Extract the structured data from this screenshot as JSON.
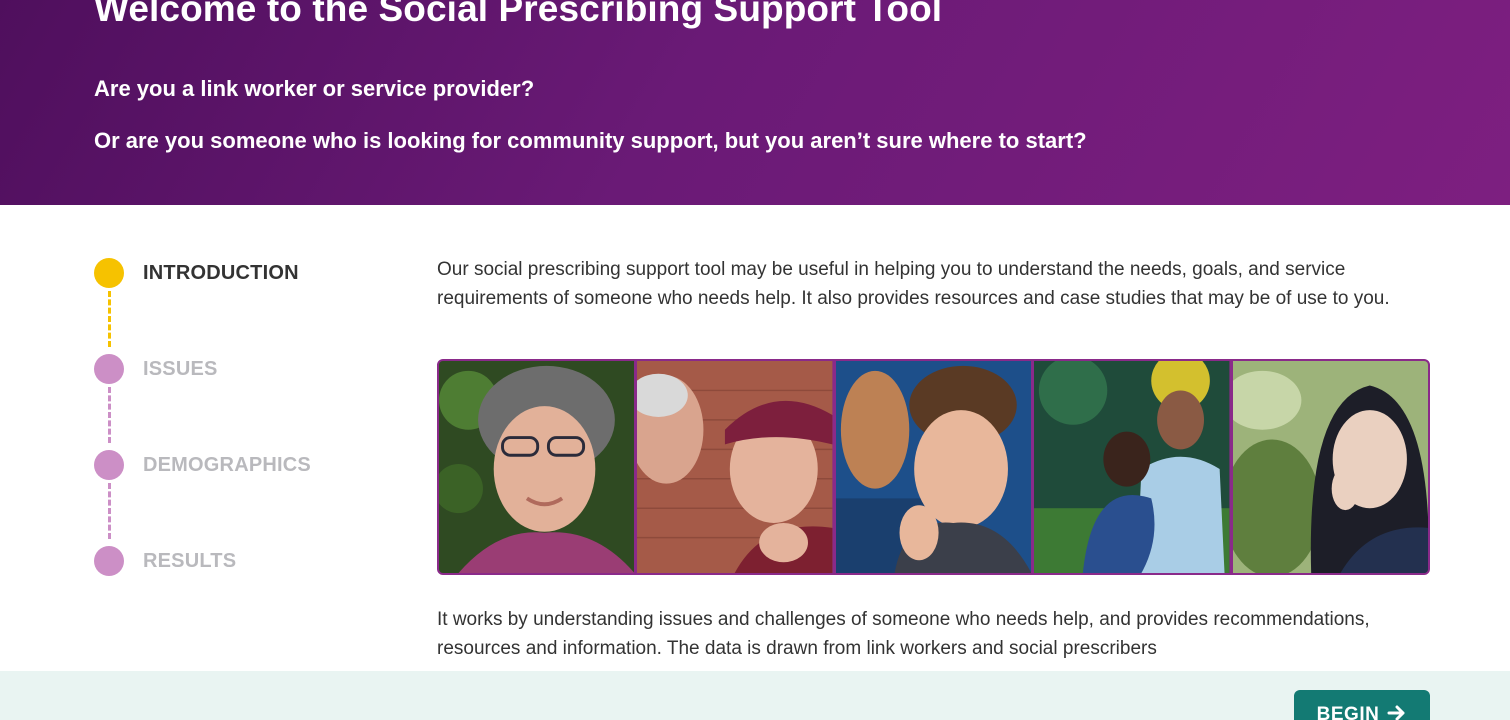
{
  "hero": {
    "title": "Welcome to the Social Prescribing Support Tool",
    "question1": "Are you a link worker or service provider?",
    "question2": "Or are you someone who is looking for community support, but you aren’t sure where to start?"
  },
  "steps": [
    {
      "label": "INTRODUCTION",
      "state": "active",
      "color": "#f6c200"
    },
    {
      "label": "ISSUES",
      "state": "inactive",
      "color": "#cc8fc6"
    },
    {
      "label": "DEMOGRAPHICS",
      "state": "inactive",
      "color": "#cc8fc6"
    },
    {
      "label": "RESULTS",
      "state": "inactive",
      "color": "#cc8fc6"
    }
  ],
  "main": {
    "intro": "Our social prescribing support tool may be useful in helping you to understand the needs, goals, and service requirements of someone who needs help. It also provides resources and case studies that may be of use to you.",
    "para2": "It works by understanding issues and challenges of someone who needs help, and provides recommendations, resources and information. The data is drawn from link workers and social prescribers"
  },
  "footer": {
    "begin_label": "BEGIN"
  },
  "colors": {
    "brand_purple": "#6a1a76",
    "active_step": "#f6c200",
    "inactive_step": "#cc8fc6",
    "button_teal": "#137a73"
  }
}
